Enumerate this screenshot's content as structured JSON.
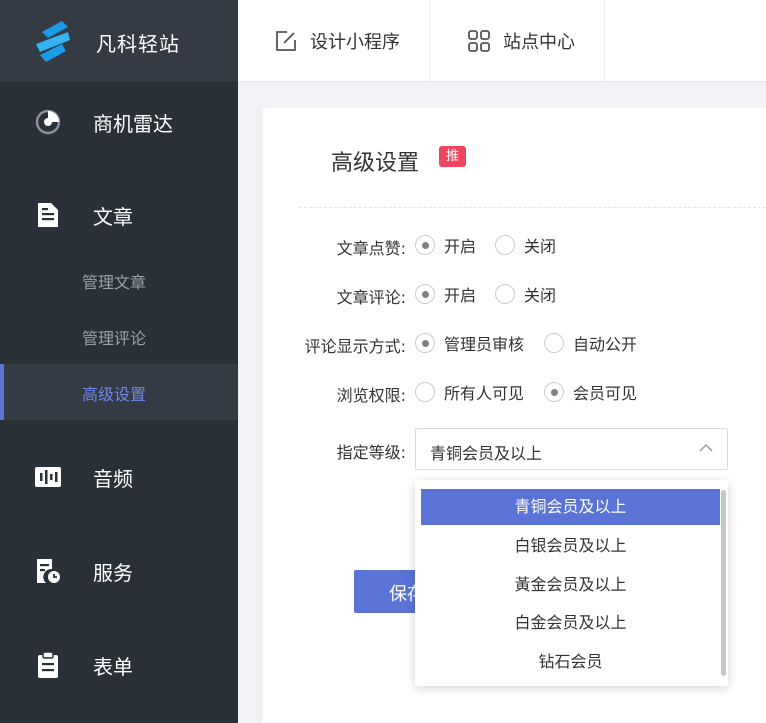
{
  "brand": {
    "name": "凡科轻站",
    "accent": "#1a9be8"
  },
  "sidebar": {
    "items": [
      {
        "label": "商机雷达",
        "icon": "radar-icon"
      },
      {
        "label": "文章",
        "icon": "document-icon"
      },
      {
        "label": "音频",
        "icon": "audio-icon"
      },
      {
        "label": "服务",
        "icon": "service-icon"
      },
      {
        "label": "表单",
        "icon": "form-icon"
      }
    ],
    "sub_items": [
      {
        "label": "管理文章"
      },
      {
        "label": "管理评论"
      },
      {
        "label": "高级设置",
        "active": true
      }
    ],
    "active_color": "#6f86e6"
  },
  "topbar": {
    "tabs": [
      {
        "label": "设计小程序",
        "icon": "edit-icon"
      },
      {
        "label": "站点中心",
        "icon": "grid-icon"
      }
    ]
  },
  "panel": {
    "title": "高级设置",
    "badge": "推",
    "badge_color": "#f0455e",
    "rows": [
      {
        "label": "文章点赞:",
        "options": [
          {
            "label": "开启",
            "checked": true
          },
          {
            "label": "关闭",
            "checked": false
          }
        ]
      },
      {
        "label": "文章评论:",
        "options": [
          {
            "label": "开启",
            "checked": true
          },
          {
            "label": "关闭",
            "checked": false
          }
        ]
      },
      {
        "label": "评论显示方式:",
        "options": [
          {
            "label": "管理员审核",
            "checked": true
          },
          {
            "label": "自动公开",
            "checked": false
          }
        ]
      },
      {
        "label": "浏览权限:",
        "options": [
          {
            "label": "所有人可见",
            "checked": false
          },
          {
            "label": "会员可见",
            "checked": true
          }
        ]
      }
    ],
    "level": {
      "label": "指定等级:",
      "value": "青铜会员及以上",
      "options": [
        "青铜会员及以上",
        "白银会员及以上",
        "黃金会员及以上",
        "白金会员及以上",
        "钻石会员"
      ]
    },
    "save_label": "保存",
    "primary_color": "#5a73d6"
  }
}
